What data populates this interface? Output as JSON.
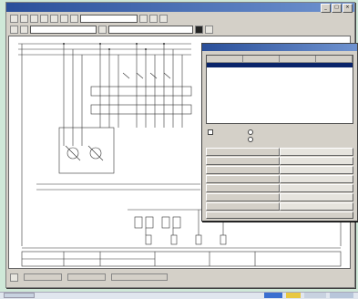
{
  "window": {
    "title": "",
    "controls": [
      "_",
      "□",
      "×"
    ]
  },
  "toolbar": {
    "combo1": "",
    "combo2": "",
    "combo3": ""
  },
  "dialog": {
    "title": "",
    "columns": [
      "",
      "",
      "",
      ""
    ],
    "rows": [
      [
        "",
        "",
        "",
        ""
      ],
      [
        "",
        "",
        "",
        ""
      ],
      [
        "",
        "",
        "",
        ""
      ],
      [
        "",
        "",
        "",
        ""
      ],
      [
        "",
        "",
        "",
        ""
      ],
      [
        "",
        "",
        "",
        ""
      ],
      [
        "",
        "",
        "",
        ""
      ],
      [
        "",
        "",
        "",
        ""
      ],
      [
        "",
        "",
        "",
        ""
      ],
      [
        "",
        "",
        "",
        ""
      ],
      [
        "",
        "",
        "",
        ""
      ],
      [
        "",
        "",
        "",
        ""
      ]
    ],
    "selected_row": 0,
    "options": [
      ""
    ],
    "grid": [
      [
        "",
        ""
      ],
      [
        "",
        ""
      ],
      [
        "",
        ""
      ],
      [
        "",
        ""
      ],
      [
        "",
        ""
      ],
      [
        "",
        ""
      ],
      [
        "",
        ""
      ]
    ],
    "ok_label": ""
  },
  "colors": {
    "title_bar": "#2a4f9a",
    "selection": "#0a246a",
    "panel": "#d4d0c8",
    "taskbar_blue": "#3a6fd0",
    "taskbar_yellow": "#e8c840"
  }
}
